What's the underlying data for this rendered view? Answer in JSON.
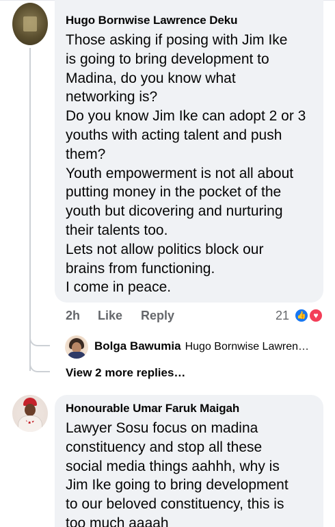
{
  "comments": [
    {
      "author": "Hugo Bornwise Lawrence Deku",
      "text": "Those asking if posing with Jim Ike\nis going to bring development to\nMadina, do you know what\nnetworking is?\nDo you know Jim Ike can adopt 2 or 3\nyouths with acting talent and push\nthem?\nYouth empowerment is not all about\nputting money in the pocket of the\nyouth but dicovering and nurturing\ntheir talents too.\nLets not allow politics block our\nbrains from functioning.\nI come in peace.",
      "time": "2h",
      "like_label": "Like",
      "reply_label": "Reply",
      "reaction_count": "21",
      "reactions": [
        "like-icon",
        "love-icon"
      ],
      "reply_preview": {
        "author": "Bolga Bawumia",
        "text": "Hugo Bornwise Lawren…"
      },
      "more_replies": "View 2 more replies…"
    },
    {
      "author": "Honourable Umar Faruk Maigah",
      "text": "Lawyer Sosu focus on madina\nconstituency and stop all these\nsocial media things aahhh, why is\nJim Ike going to bring development\nto our beloved constituency, this is\ntoo much aaaah"
    }
  ],
  "colors": {
    "bubble": "#f0f2f5",
    "meta_text": "#65676b",
    "like_blue": "#1877f2",
    "love_red": "#f33e58"
  }
}
